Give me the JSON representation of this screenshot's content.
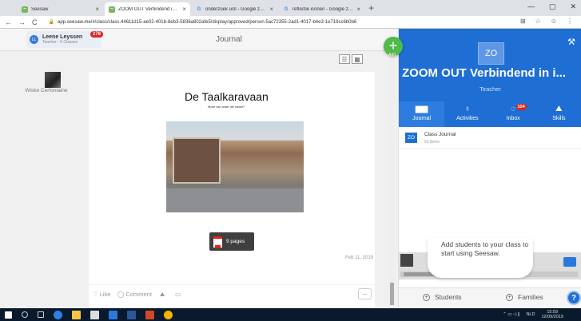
{
  "browser": {
    "tabs": [
      {
        "label": "Seesaw",
        "icon": "seesaw-favicon",
        "color": "#7bb661"
      },
      {
        "label": "ZOOM OUT Verbindend in intera",
        "icon": "seesaw-favicon",
        "color": "#7bb661",
        "active": true
      },
      {
        "label": "onderzoek ucll - Google zoeken",
        "icon": "google-favicon",
        "color": "#4285f4"
      },
      {
        "label": "reflectie iconen - Google zoeken",
        "icon": "google-favicon",
        "color": "#4285f4"
      }
    ],
    "new_tab": "+",
    "url": "app.seesaw.me/#/class/class.44611d15-ae02-401b-8eb3-5836a802afe5/display/approved/person.5ac72355-2ad1-4017-b4e3-1e719cc6b0b6"
  },
  "header": {
    "user_name": "Leene Leyssen",
    "user_sub": "Teacher - 5 Classes",
    "user_initials": "LL",
    "notification_count": "278",
    "page_title": "Journal"
  },
  "student": {
    "name": "Wiske Cerfontaine"
  },
  "post": {
    "title": "De Taalkaravaan",
    "subtitle": "Maar van waar die naam?",
    "pdf_label": "9 pages",
    "date": "Feb 11, 2019",
    "like": "Like",
    "comment": "Comment",
    "more": "..."
  },
  "fab": {
    "label": "Add",
    "symbol": "+"
  },
  "class_panel": {
    "initials": "ZO",
    "name": "ZOOM OUT Verbindend in i...",
    "role": "Teacher",
    "tabs": [
      {
        "label": "Journal",
        "icon": "journal-icon"
      },
      {
        "label": "Activities",
        "icon": "lightbulb-icon"
      },
      {
        "label": "Inbox",
        "icon": "inbox-icon",
        "badge": "104"
      },
      {
        "label": "Skills",
        "icon": "skills-icon"
      }
    ],
    "journal_title": "Class Journal",
    "journal_count": "63 items",
    "tip": "Add students to your class to start using Seesaw.",
    "students_button": "Students",
    "families_button": "Families",
    "help": "?"
  },
  "taskbar": {
    "lang": "NLD",
    "time": "15:59",
    "date": "12/09/2019"
  },
  "colors": {
    "brand": "#1f6ed4",
    "add": "#52b94b",
    "badge": "#e2231a"
  }
}
